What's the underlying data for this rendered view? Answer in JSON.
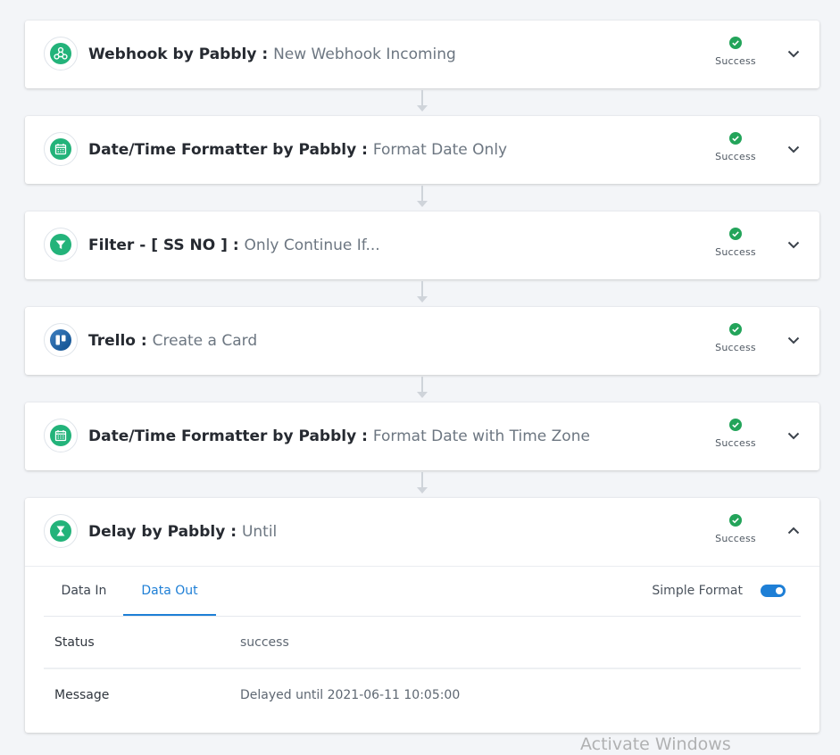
{
  "colors": {
    "success": "#23a45a",
    "app_green": "#23b37a",
    "accent_blue": "#1e7fd6"
  },
  "steps": [
    {
      "app": "Webhook by Pabbly",
      "separator": " : ",
      "action": "New Webhook Incoming",
      "icon": "webhook-icon",
      "status": "Success",
      "expanded": false
    },
    {
      "app": "Date/Time Formatter by Pabbly",
      "separator": " : ",
      "action": "Format Date Only",
      "icon": "calendar-icon",
      "status": "Success",
      "expanded": false
    },
    {
      "app": "Filter - [ SS NO ]",
      "separator": " : ",
      "action": "Only Continue If...",
      "icon": "filter-icon",
      "status": "Success",
      "expanded": false
    },
    {
      "app": "Trello",
      "separator": " : ",
      "action": "Create a Card",
      "icon": "trello-icon",
      "status": "Success",
      "expanded": false
    },
    {
      "app": "Date/Time Formatter by Pabbly",
      "separator": " : ",
      "action": "Format Date with Time Zone",
      "icon": "calendar-icon",
      "status": "Success",
      "expanded": false
    },
    {
      "app": "Delay by Pabbly",
      "separator": " : ",
      "action": "Until",
      "icon": "hourglass-icon",
      "status": "Success",
      "expanded": true
    }
  ],
  "detail": {
    "tabs": [
      {
        "label": "Data In",
        "active": false
      },
      {
        "label": "Data Out",
        "active": true
      }
    ],
    "simple_format_label": "Simple Format",
    "simple_format_on": true,
    "rows": [
      {
        "key": "Status",
        "value": "success"
      },
      {
        "key": "Message",
        "value": "Delayed until 2021-06-11 10:05:00"
      }
    ]
  },
  "watermark": "Activate Windows"
}
